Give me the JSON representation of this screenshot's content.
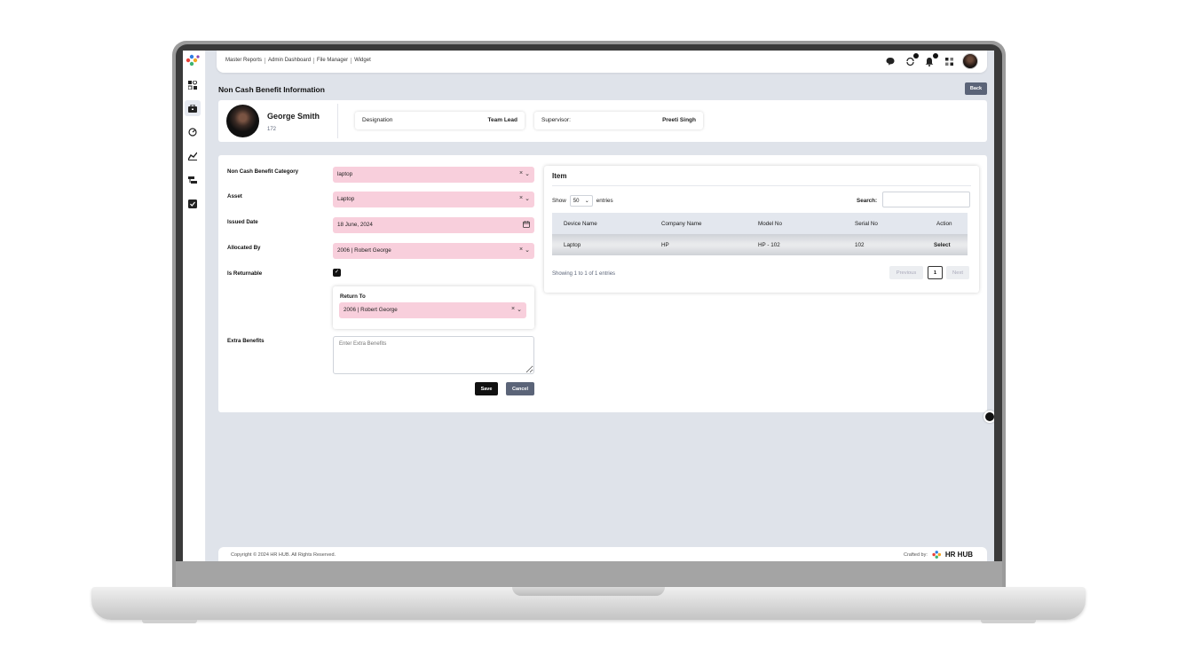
{
  "nav": {
    "links": [
      "Master Reports",
      "Admin Dashboard",
      "File Manager",
      "Widget"
    ]
  },
  "sidebar": {
    "icons": [
      "apps-icon",
      "briefcase-icon",
      "gauge-icon",
      "chart-icon",
      "layers-icon",
      "checklist-icon"
    ]
  },
  "page": {
    "title": "Non Cash Benefit Information",
    "back_label": "Back"
  },
  "profile": {
    "name": "George Smith",
    "id": "172",
    "designation_label": "Designation",
    "designation_value": "Team Lead",
    "supervisor_label": "Supervisor:",
    "supervisor_value": "Preeti Singh"
  },
  "form": {
    "category_label": "Non Cash Benefit Category",
    "category_value": "laptop",
    "asset_label": "Asset",
    "asset_value": "Laptop",
    "issued_label": "Issued Date",
    "issued_value": "18 June, 2024",
    "allocated_label": "Allocated By",
    "allocated_value": "2006 | Robert George",
    "returnable_label": "Is Returnable",
    "returnable_checked": true,
    "return_to_label": "Return To",
    "return_to_value": "2006 | Robert George",
    "extra_label": "Extra Benefits",
    "extra_placeholder": "Enter Extra Benefits",
    "save_label": "Save",
    "cancel_label": "Cancel"
  },
  "items": {
    "title": "Item",
    "show_label": "Show",
    "page_length": "50",
    "entries_label": "entries",
    "search_label": "Search:",
    "columns": [
      "Device Name",
      "Company Name",
      "Model No",
      "Serial No",
      "Action"
    ],
    "rows": [
      {
        "device": "Laptop",
        "company": "HP",
        "model": "HP - 102",
        "serial": "102",
        "action": "Select"
      }
    ],
    "info": "Showing 1 to 1 of 1 entries",
    "prev_label": "Previous",
    "current_page": "1",
    "next_label": "Next"
  },
  "footer": {
    "copyright": "Copyright © 2024 HR HUB. All Rights Reserved.",
    "crafted_by": "Crafted by:",
    "brand": "HR HUB"
  }
}
